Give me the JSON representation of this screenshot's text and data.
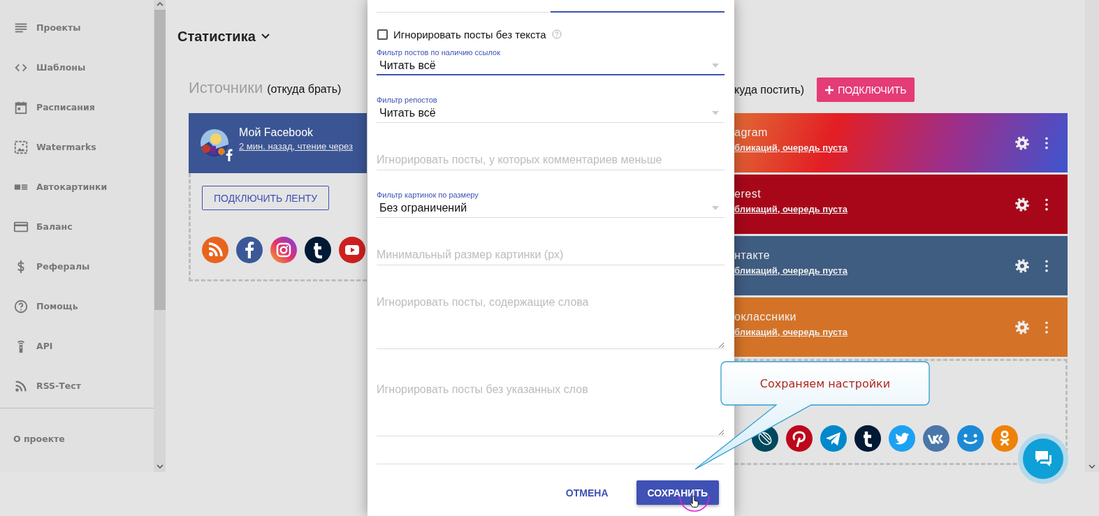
{
  "sidebar": {
    "items": [
      {
        "label": "Проекты"
      },
      {
        "label": "Шаблоны"
      },
      {
        "label": "Расписания"
      },
      {
        "label": "Watermarks"
      },
      {
        "label": "Автокартинки"
      },
      {
        "label": "Баланс"
      },
      {
        "label": "Рефералы"
      },
      {
        "label": "Помощь"
      },
      {
        "label": "API"
      },
      {
        "label": "RSS-Тест"
      }
    ],
    "footer": "О проекте"
  },
  "page_title": "Статистика",
  "sources": {
    "heading": "Источники",
    "heading_note": "(откуда брать)",
    "card": {
      "title": "Мой Facebook",
      "subtitle": "2 мин. назад, чтение через"
    },
    "connect_button": "ПОДКЛЮЧИТЬ ЛЕНТУ"
  },
  "destinations": {
    "heading_note": "куда постить)",
    "connect_button": "ПОДКЛЮЧИТЬ",
    "cards": [
      {
        "kind": "gradient",
        "title": "agram",
        "subtitle": "бликаций, очередь пуста"
      },
      {
        "kind": "solid",
        "color": "#a8071a",
        "title": "erest",
        "subtitle": "бликаций, очередь пуста"
      },
      {
        "kind": "solid",
        "color": "#3f5c81",
        "title": "нтакте",
        "subtitle": "бликаций, очередь пуста"
      },
      {
        "kind": "solid",
        "color": "#d47327",
        "title": "оклассники",
        "subtitle": "бликаций, очередь пуста"
      }
    ]
  },
  "modal": {
    "fields": [
      {
        "kind": "checkbox",
        "label": "Игнорировать посты без текста",
        "checked": false
      },
      {
        "kind": "select",
        "label": "Фильтр постов по наличию ссылок",
        "value": "Читать всё",
        "focused": true
      },
      {
        "kind": "select",
        "label": "Фильтр репостов",
        "value": "Читать всё",
        "focused": false
      },
      {
        "kind": "input",
        "placeholder": "Игнорировать посты, у которых комментариев меньше"
      },
      {
        "kind": "select",
        "label": "Фильтр картинок по размеру",
        "value": "Без ограничений",
        "focused": false
      },
      {
        "kind": "input",
        "placeholder": "Минимальный размер картинки (px)"
      },
      {
        "kind": "textarea",
        "placeholder": "Игнорировать посты, содержащие слова"
      },
      {
        "kind": "textarea",
        "placeholder": "Игнорировать посты без указанных слов"
      },
      {
        "kind": "input"
      }
    ],
    "buttons": [
      {
        "kind": "flat",
        "label": "ОТМЕНА"
      },
      {
        "kind": "raised",
        "label": "СОХРАНИТЬ"
      }
    ]
  },
  "callout": {
    "text": "Сохраняем настройки"
  }
}
